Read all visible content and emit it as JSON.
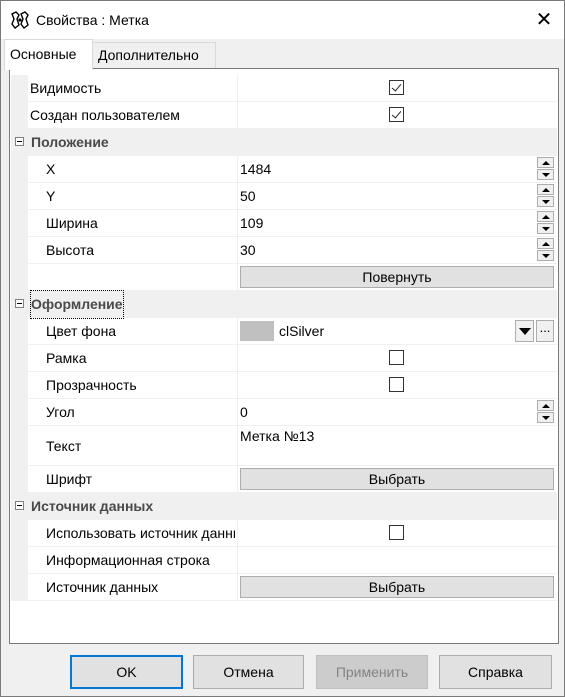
{
  "window": {
    "title": "Свойства : Метка",
    "app_icon": "properties-app-icon",
    "close_label": "✕"
  },
  "tabs": [
    {
      "label": "Основные",
      "active": true
    },
    {
      "label": "Дополнительно",
      "active": false
    }
  ],
  "rows": {
    "visibility": {
      "label": "Видимость",
      "checked": true
    },
    "user_created": {
      "label": "Создан пользователем",
      "checked": true
    },
    "cat_position": {
      "label": "Положение"
    },
    "x": {
      "label": "X",
      "value": "1484"
    },
    "y": {
      "label": "Y",
      "value": "50"
    },
    "width": {
      "label": "Ширина",
      "value": "109"
    },
    "height": {
      "label": "Высота",
      "value": "30"
    },
    "rotate": {
      "button": "Повернуть"
    },
    "cat_style": {
      "label": "Оформление"
    },
    "bg_color": {
      "label": "Цвет фона",
      "value": "clSilver",
      "swatch": "#c0c0c0",
      "dots": "..."
    },
    "frame": {
      "label": "Рамка",
      "checked": false
    },
    "transparency": {
      "label": "Прозрачность",
      "checked": false
    },
    "angle": {
      "label": "Угол",
      "value": "0"
    },
    "text": {
      "label": "Текст",
      "value": "Метка №13"
    },
    "font": {
      "label": "Шрифт",
      "button": "Выбрать"
    },
    "cat_datasource": {
      "label": "Источник данных"
    },
    "use_datasource": {
      "label": "Использовать источник данных",
      "checked": false
    },
    "info_string": {
      "label": "Информационная строка",
      "value": ""
    },
    "datasource": {
      "label": "Источник данных",
      "button": "Выбрать"
    }
  },
  "footer": {
    "ok": "OK",
    "cancel": "Отмена",
    "apply": "Применить",
    "help": "Справка"
  },
  "colors": {
    "accent": "#0078d7",
    "category_text": "#4a4a4a"
  }
}
